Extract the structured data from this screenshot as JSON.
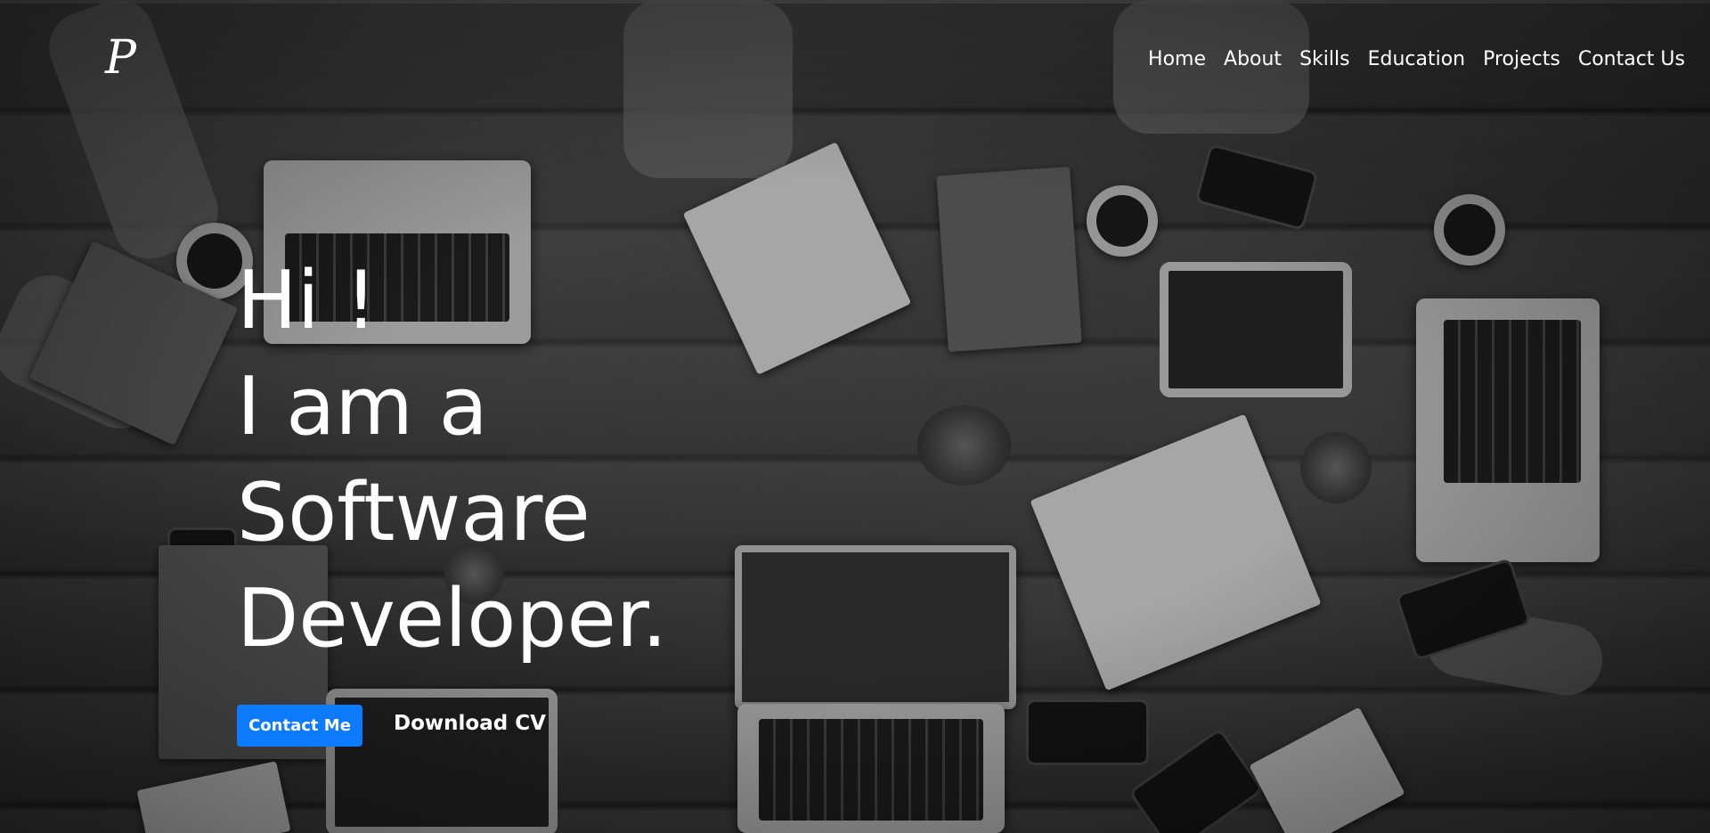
{
  "brand": {
    "logo_text": "P"
  },
  "nav": {
    "items": [
      {
        "label": "Home"
      },
      {
        "label": "About"
      },
      {
        "label": "Skills"
      },
      {
        "label": "Education"
      },
      {
        "label": "Projects"
      },
      {
        "label": "Contact Us"
      }
    ]
  },
  "hero": {
    "lines": [
      "Hi !",
      "I am a",
      "Software",
      "Developer."
    ],
    "primary_button": "Contact Me",
    "secondary_link": "Download CV"
  },
  "colors": {
    "accent": "#0d7bff",
    "text": "#ffffff"
  }
}
